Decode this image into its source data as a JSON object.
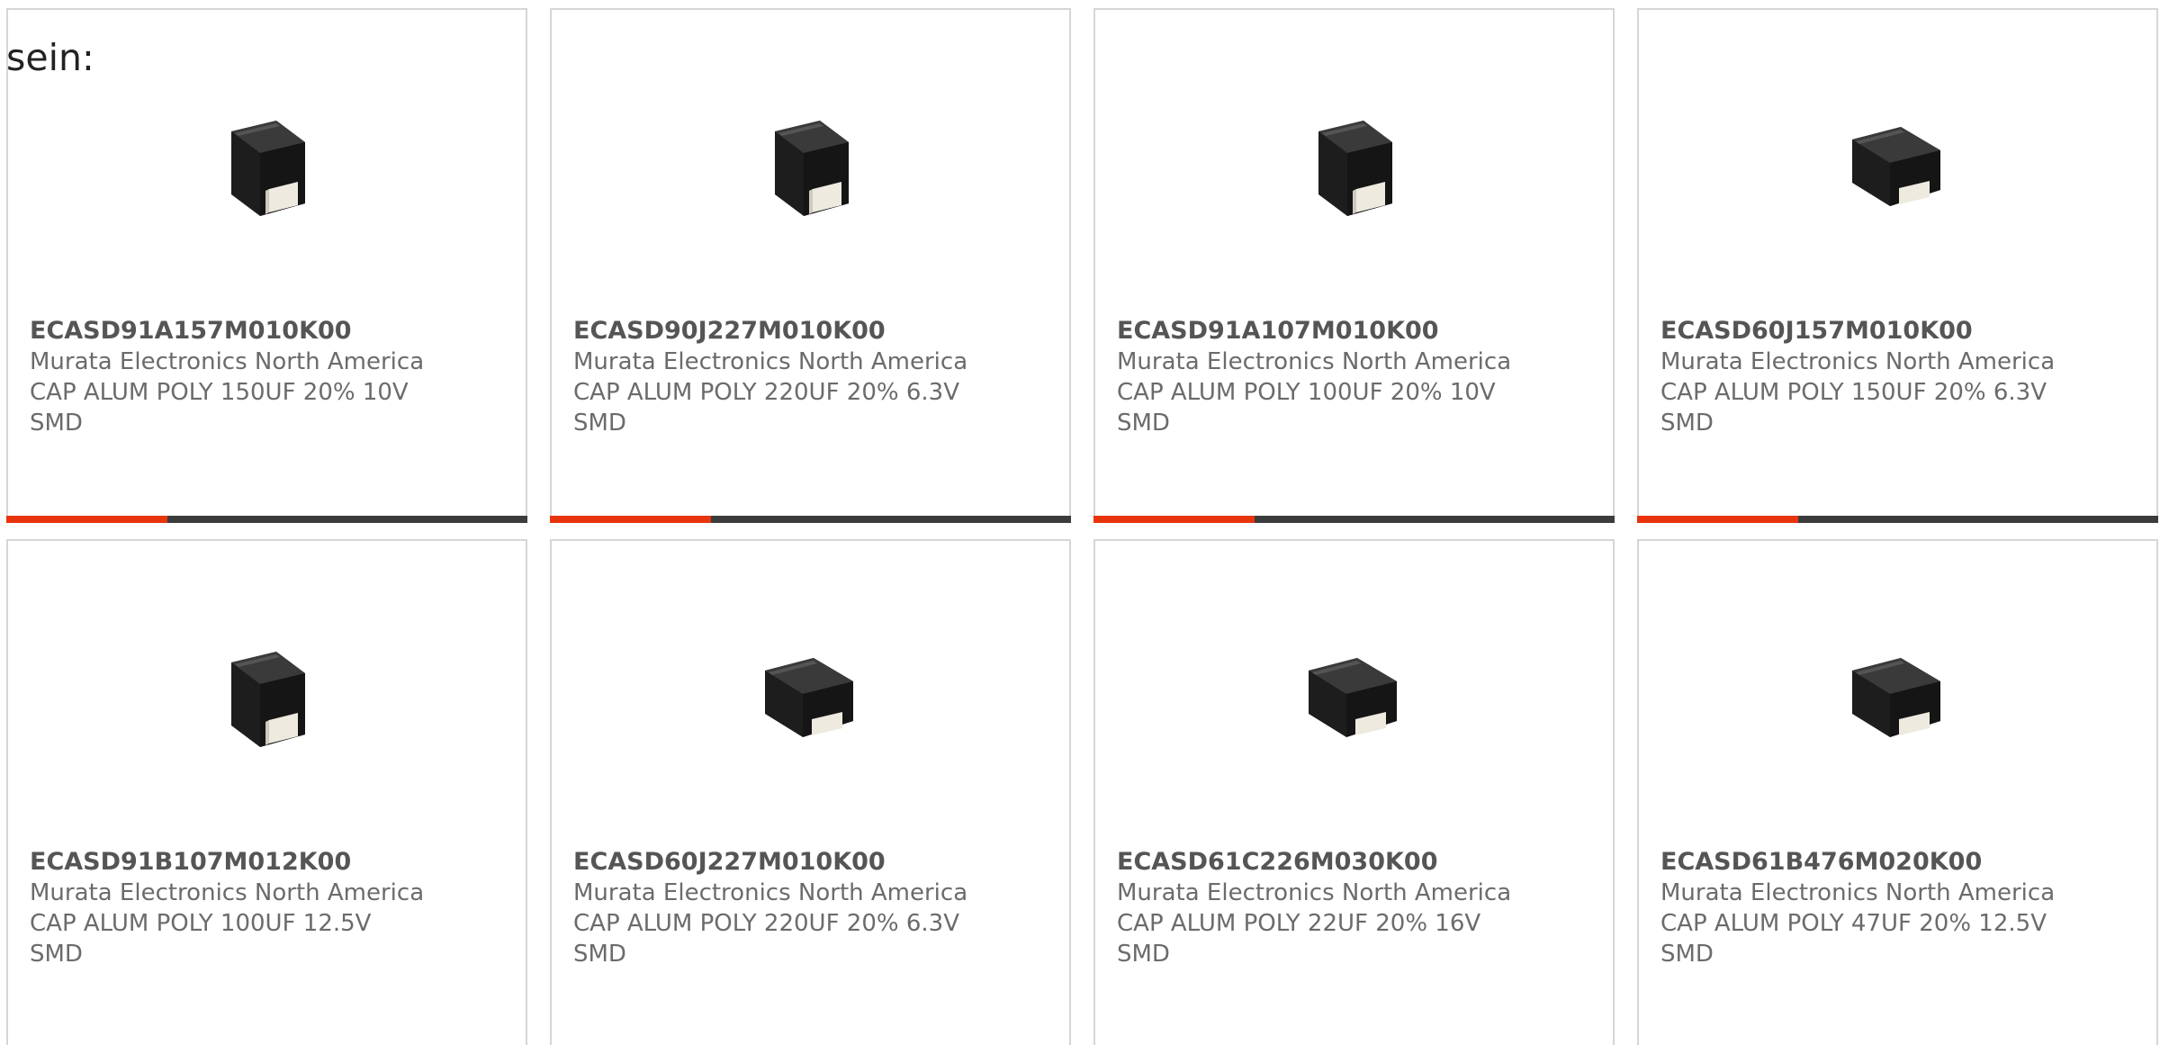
{
  "intro": "sein:",
  "colors": {
    "accent": "#e8340c",
    "progress_track": "#3c3c3c",
    "card_border": "#d6d6d6"
  },
  "cards": [
    {
      "part_number": "ECASD91A157M010K00",
      "manufacturer": "Murata Electronics North America",
      "description_line1": "CAP ALUM POLY 150UF 20% 10V",
      "description_line2": "SMD",
      "image_icon": "smd-capacitor-icon",
      "progress": 0.31
    },
    {
      "part_number": "ECASD90J227M010K00",
      "manufacturer": "Murata Electronics North America",
      "description_line1": "CAP ALUM POLY 220UF 20% 6.3V",
      "description_line2": "SMD",
      "image_icon": "smd-capacitor-icon",
      "progress": 0.31
    },
    {
      "part_number": "ECASD91A107M010K00",
      "manufacturer": "Murata Electronics North America",
      "description_line1": "CAP ALUM POLY 100UF 20% 10V",
      "description_line2": "SMD",
      "image_icon": "smd-capacitor-icon",
      "progress": 0.31
    },
    {
      "part_number": "ECASD60J157M010K00",
      "manufacturer": "Murata Electronics North America",
      "description_line1": "CAP ALUM POLY 150UF 20% 6.3V",
      "description_line2": "SMD",
      "image_icon": "smd-capacitor-icon",
      "progress": 0.31
    },
    {
      "part_number": "ECASD91B107M012K00",
      "manufacturer": "Murata Electronics North America",
      "description_line1": "CAP ALUM POLY 100UF 12.5V",
      "description_line2": "SMD",
      "image_icon": "smd-capacitor-icon"
    },
    {
      "part_number": "ECASD60J227M010K00",
      "manufacturer": "Murata Electronics North America",
      "description_line1": "CAP ALUM POLY 220UF 20% 6.3V",
      "description_line2": "SMD",
      "image_icon": "smd-capacitor-icon"
    },
    {
      "part_number": "ECASD61C226M030K00",
      "manufacturer": "Murata Electronics North America",
      "description_line1": "CAP ALUM POLY 22UF 20% 16V",
      "description_line2": "SMD",
      "image_icon": "smd-capacitor-icon"
    },
    {
      "part_number": "ECASD61B476M020K00",
      "manufacturer": "Murata Electronics North America",
      "description_line1": "CAP ALUM POLY 47UF 20% 12.5V",
      "description_line2": "SMD",
      "image_icon": "smd-capacitor-icon"
    }
  ]
}
